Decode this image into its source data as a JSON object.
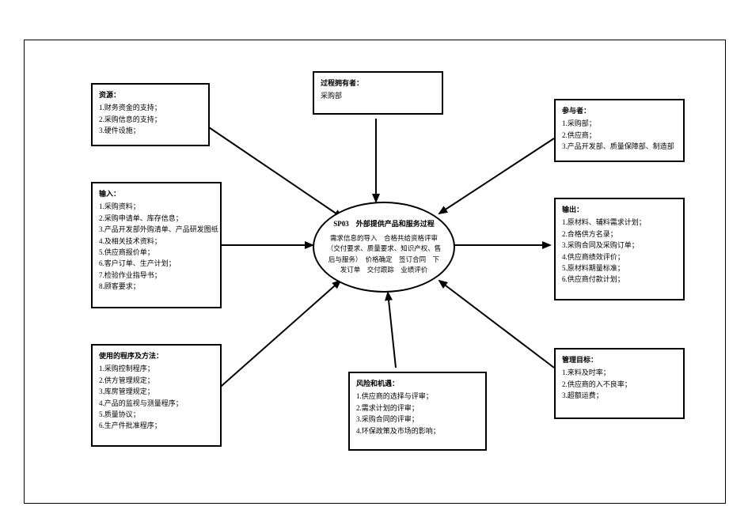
{
  "diagram": {
    "center": {
      "title": "SP03　外部提供产品和服务过程",
      "body": "需求信息的导入　合格共给资格评审（交付要求、质量要求、知识产权、售后与服务）　价格确定　签订合同　下发订单　交付跟踪　业绩评价"
    },
    "box_process_owner": {
      "title": "过程拥有者：",
      "items": [
        "采购部"
      ]
    },
    "box_resources": {
      "title": "资源：",
      "items": [
        "1.财务资金的支持；",
        "2.采购信息的支持；",
        "3.硬件设施；"
      ]
    },
    "box_input": {
      "title": "输入：",
      "items": [
        "1.采购资料；",
        "2.采购申请单、库存信息；",
        "3.产品开发部外购清单、产品研发图纸",
        "4.及相关技术资料；",
        "5.供应商报价单；",
        "6.客户订单、生产计划；",
        "7.检验作业指导书；",
        "8.顾客要求；"
      ]
    },
    "box_methods": {
      "title": "使用的程序及方法：",
      "items": [
        "1.采购控制程序；",
        "2.供方管理规定；",
        "3.库房管理规定；",
        "4.产品的监视与测量程序；",
        "5.质量协议；",
        "6.生产件批准程序；"
      ]
    },
    "box_risk": {
      "title": "风险和机遇：",
      "items": [
        "1.供应商的选择与评审；",
        "2.需求计划的评审；",
        "3.采购合同的评审；",
        "4.环保政策及市场的影响；"
      ]
    },
    "box_participants": {
      "title": "参与者：",
      "items": [
        "1.采购部；",
        "2.供应商；",
        "3.产品开发部、质量保障部、制造部"
      ]
    },
    "box_output": {
      "title": "输出：",
      "items": [
        "1.原材料、辅料需求计划；",
        "2.合格供方名录；",
        "3.采购合同及采购订单；",
        "4.供应商绩效评价；",
        "5.原材料期量标准；",
        "6.供应商付款计划；"
      ]
    },
    "box_targets": {
      "title": "管理目标：",
      "items": [
        "1.来料及时率；",
        "2.供应商的入不良率；",
        "3.超额运费；"
      ]
    }
  }
}
